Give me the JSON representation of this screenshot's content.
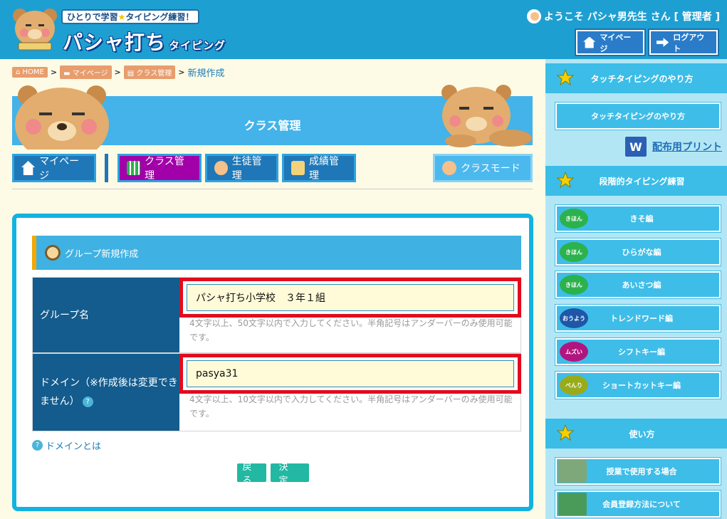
{
  "header": {
    "tagline_a": "ひとりで学習",
    "tagline_star": "★",
    "tagline_b": "タイピング練習！",
    "logo_main": "パシャ打ち",
    "logo_sub": "タイピング",
    "welcome": "ようこそ パシャ男先生 さん [ 管理者 ]",
    "mypage_label": "マイページ",
    "logout_label": "ログアウト"
  },
  "breadcrumb": {
    "home": "HOME",
    "mypage": "マイページ",
    "class": "クラス管理",
    "current": "新規作成",
    "sep": ">"
  },
  "banner": {
    "title": "クラス管理"
  },
  "nav": {
    "mypage": "マイページ",
    "class": "クラス管理",
    "student": "生徒管理",
    "score": "成績管理",
    "mode": "クラスモード"
  },
  "form": {
    "heading": "グループ新規作成",
    "group_label": "グループ名",
    "group_value": "パシャ打ち小学校　３年１組",
    "group_hint": "4文字以上、50文字以内で入力してください。半角記号はアンダーバーのみ使用可能です。",
    "domain_label": "ドメイン（※作成後は変更できません）",
    "domain_value": "pasya31",
    "domain_hint": "4文字以上、10文字以内で入力してください。半角記号はアンダーバーのみ使用可能です。",
    "help_mark": "?",
    "domain_link": "ドメインとは",
    "back": "戻る",
    "decide": "決定"
  },
  "sidebar": {
    "touch_head": "タッチタイピングのやり方",
    "touch_btn": "タッチタイピングのやり方",
    "word_letter": "W",
    "print_link": "配布用プリント",
    "step_head": "段階的タイピング練習",
    "courses": [
      {
        "level": "きほん",
        "label": "きそ編"
      },
      {
        "level": "きほん",
        "label": "ひらがな編"
      },
      {
        "level": "きほん",
        "label": "あいさつ編"
      },
      {
        "level": "おうよう",
        "label": "トレンドワード編"
      },
      {
        "level": "ムズい",
        "label": "シフトキー編"
      },
      {
        "level": "べんり",
        "label": "ショートカットキー編"
      }
    ],
    "usage_head": "使い方",
    "usage_1": "授業で使用する場合",
    "usage_2": "会員登録方法について"
  }
}
